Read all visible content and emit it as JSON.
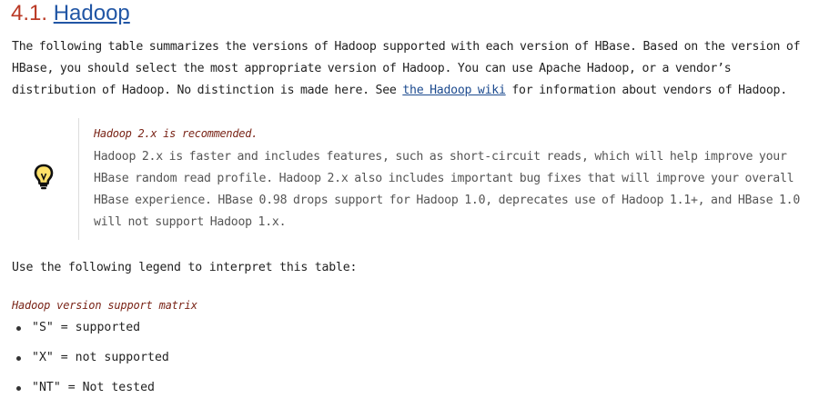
{
  "section": {
    "number": "4.1.",
    "title": "Hadoop"
  },
  "intro": {
    "text_before_link": "The following table summarizes the versions of Hadoop supported with each version of HBase. Based on the version of HBase, you should select the most appropriate version of Hadoop. You can use Apache Hadoop, or a vendor’s distribution of Hadoop. No distinction is made here. See ",
    "link_text": "the Hadoop wiki",
    "text_after_link": " for information about vendors of Hadoop."
  },
  "tip": {
    "icon": "lightbulb-icon",
    "title": "Hadoop 2.x is recommended.",
    "body": "Hadoop 2.x is faster and includes features, such as short-circuit reads, which will help improve your HBase random read profile. Hadoop 2.x also includes important bug fixes that will improve your overall HBase experience. HBase 0.98 drops support for Hadoop 1.0, deprecates use of Hadoop 1.1+, and HBase 1.0 will not support Hadoop 1.x."
  },
  "legend_intro": "Use the following legend to interpret this table:",
  "matrix_title": "Hadoop version support matrix",
  "legend_items": [
    "\"S\" = supported",
    "\"X\" = not supported",
    "\"NT\" = Not tested"
  ]
}
